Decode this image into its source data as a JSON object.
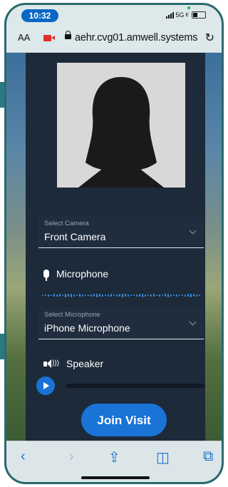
{
  "status_bar": {
    "time": "10:32",
    "network": "5G",
    "network_suffix": "E"
  },
  "address_bar": {
    "text_size_label": "AA",
    "url": "aehr.cvg01.amwell.systems"
  },
  "camera": {
    "label": "Select Camera",
    "value": "Front Camera"
  },
  "microphone": {
    "section_label": "Microphone",
    "select_label": "Select Microphone",
    "select_value": "iPhone Microphone"
  },
  "speaker": {
    "section_label": "Speaker"
  },
  "join_button": {
    "label": "Join Visit"
  },
  "colors": {
    "accent": "#1a73d6",
    "panel": "#1c2a3a",
    "toolbar_bg": "#dce6e8"
  },
  "icons": {
    "reload": "reload-icon",
    "camera_permission": "camera-icon",
    "lock": "lock-icon",
    "back": "back-icon",
    "forward": "forward-icon",
    "share": "share-icon",
    "bookmarks": "bookmarks-icon",
    "tabs": "tabs-icon"
  }
}
